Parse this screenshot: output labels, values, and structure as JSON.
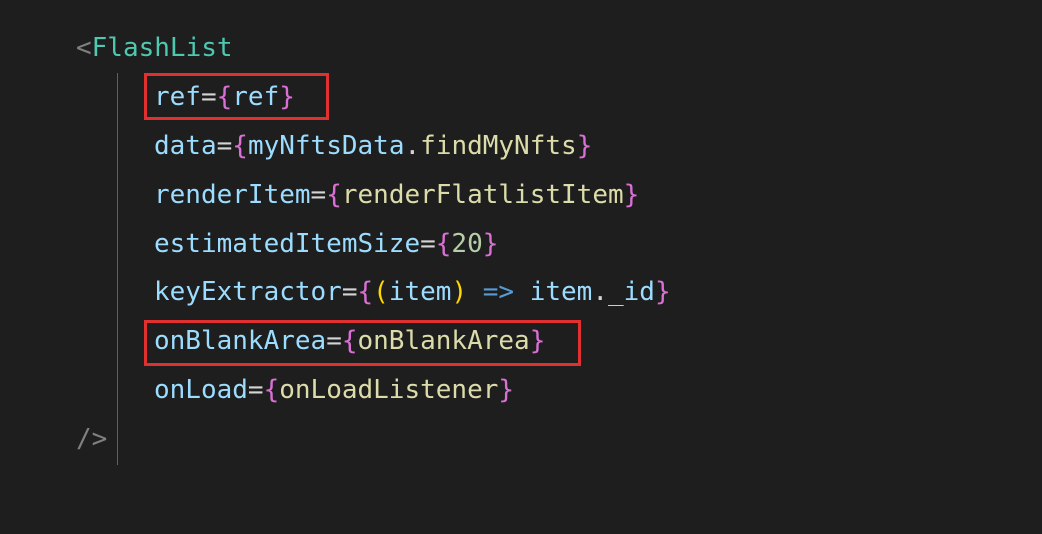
{
  "code": {
    "line1": {
      "open": "<",
      "component": "FlashList"
    },
    "line2": {
      "attr": "ref",
      "eq": "=",
      "lbrace": "{",
      "value": "ref",
      "rbrace": "}"
    },
    "line3": {
      "attr": "data",
      "eq": "=",
      "lbrace": "{",
      "obj": "myNftsData",
      "dot": ".",
      "prop": "findMyNfts",
      "rbrace": "}"
    },
    "line4": {
      "attr": "renderItem",
      "eq": "=",
      "lbrace": "{",
      "value": "renderFlatlistItem",
      "rbrace": "}"
    },
    "line5": {
      "attr": "estimatedItemSize",
      "eq": "=",
      "lbrace": "{",
      "value": "20",
      "rbrace": "}"
    },
    "line6": {
      "attr": "keyExtractor",
      "eq": "=",
      "lbrace": "{",
      "lparen": "(",
      "param": "item",
      "rparen": ")",
      "arrow": " => ",
      "obj": "item",
      "dot": ".",
      "prop": "_id",
      "rbrace": "}"
    },
    "line7": {
      "attr": "onBlankArea",
      "eq": "=",
      "lbrace": "{",
      "value": "onBlankArea",
      "rbrace": "}"
    },
    "line8": {
      "attr": "onLoad",
      "eq": "=",
      "lbrace": "{",
      "value": "onLoadListener",
      "rbrace": "}"
    },
    "line9": {
      "close": "/>"
    }
  }
}
